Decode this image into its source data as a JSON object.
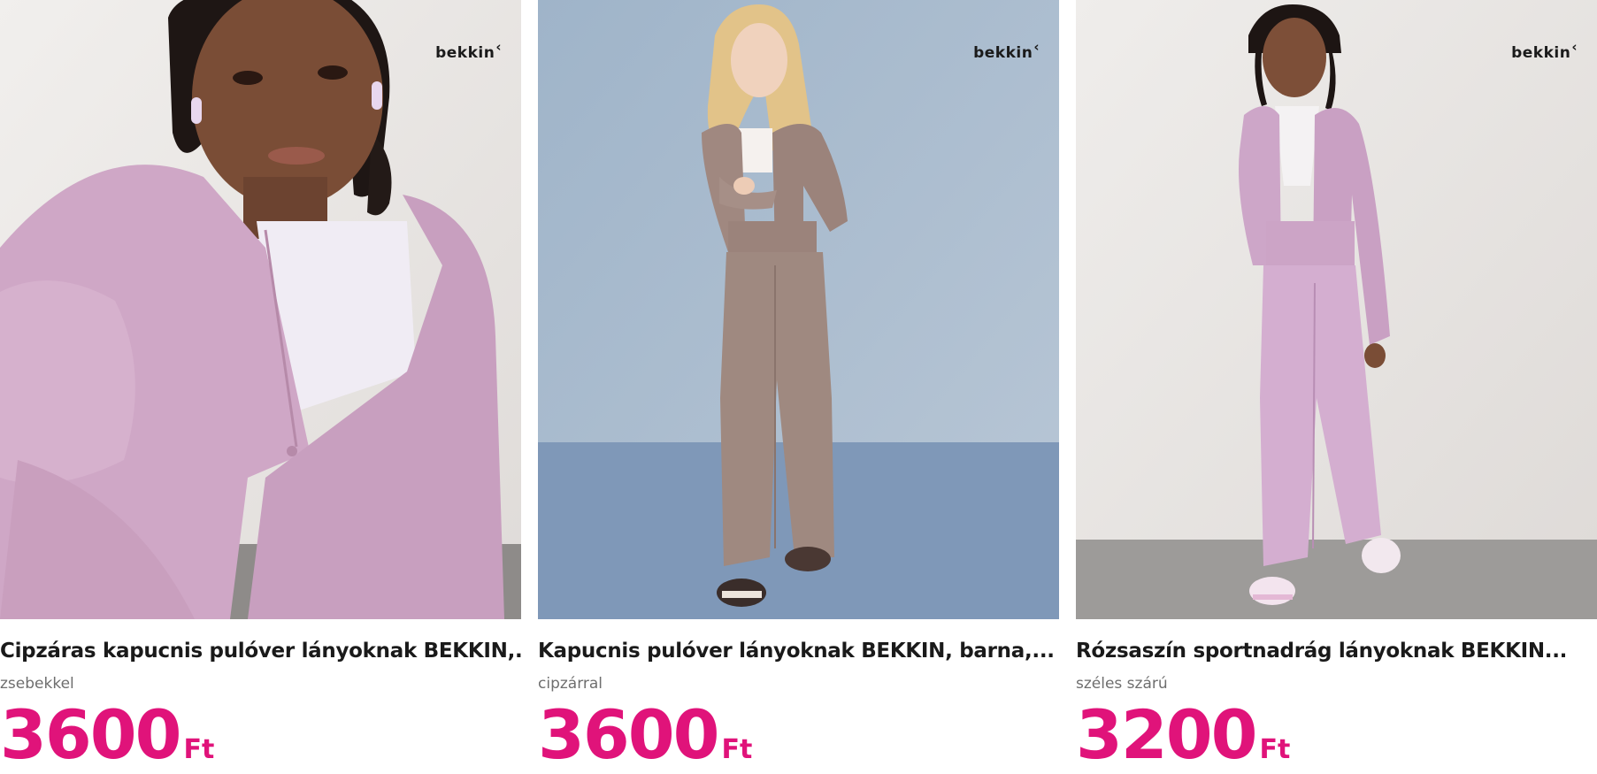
{
  "products": [
    {
      "brand": "bekkin",
      "title": "Cipzáras kapucnis pulóver lányoknak BEKKIN,...",
      "subtitle": "zsebekkel",
      "price": "3600",
      "currency": "Ft",
      "image": "girl-sitting-pink-zip-hoodie"
    },
    {
      "brand": "bekkin",
      "title": "Kapucnis pulóver lányoknak BEKKIN, barna,...",
      "subtitle": "cipzárral",
      "price": "3600",
      "currency": "Ft",
      "image": "girl-standing-brown-tracksuit"
    },
    {
      "brand": "bekkin",
      "title": "Rózsaszín sportnadrág lányoknak BEKKIN...",
      "subtitle": "széles szárú",
      "price": "3200",
      "currency": "Ft",
      "image": "girl-standing-pink-tracksuit"
    }
  ],
  "colors": {
    "price": "#e0137a",
    "title": "#1a1a1a",
    "subtitle": "#6e6e6e",
    "pink_outfit": "#d2a9c7",
    "brown_outfit": "#9c8479",
    "blue_backdrop": "#8fa6bf"
  }
}
